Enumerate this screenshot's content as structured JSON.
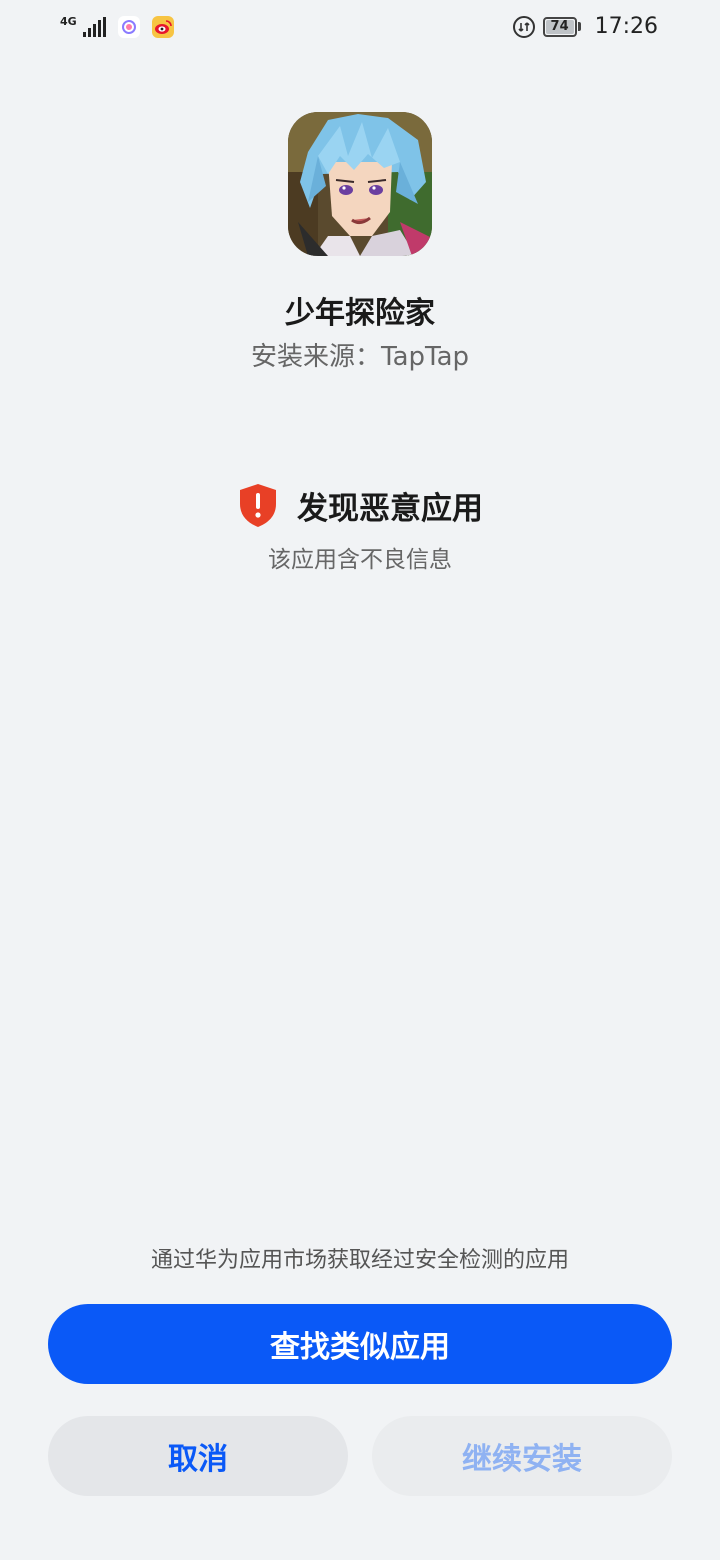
{
  "status_bar": {
    "network": "4G",
    "battery": "74",
    "time": "17:26",
    "icons": [
      "signal-icon",
      "browser-notification-icon",
      "weibo-notification-icon",
      "data-saver-icon",
      "battery-icon"
    ]
  },
  "app": {
    "name": "少年探险家",
    "install_source": "安装来源：TapTap",
    "icon": "app-icon-anime-character"
  },
  "warning": {
    "icon": "shield-alert-icon",
    "title": "发现恶意应用",
    "subtitle": "该应用含不良信息",
    "color": "#e84026"
  },
  "hint": "通过华为应用市场获取经过安全检测的应用",
  "buttons": {
    "find_similar": "查找类似应用",
    "cancel": "取消",
    "continue_install": "继续安装"
  },
  "colors": {
    "accent": "#0a59f7",
    "background": "#f1f3f5",
    "disabled_text": "#8fb2f2"
  }
}
